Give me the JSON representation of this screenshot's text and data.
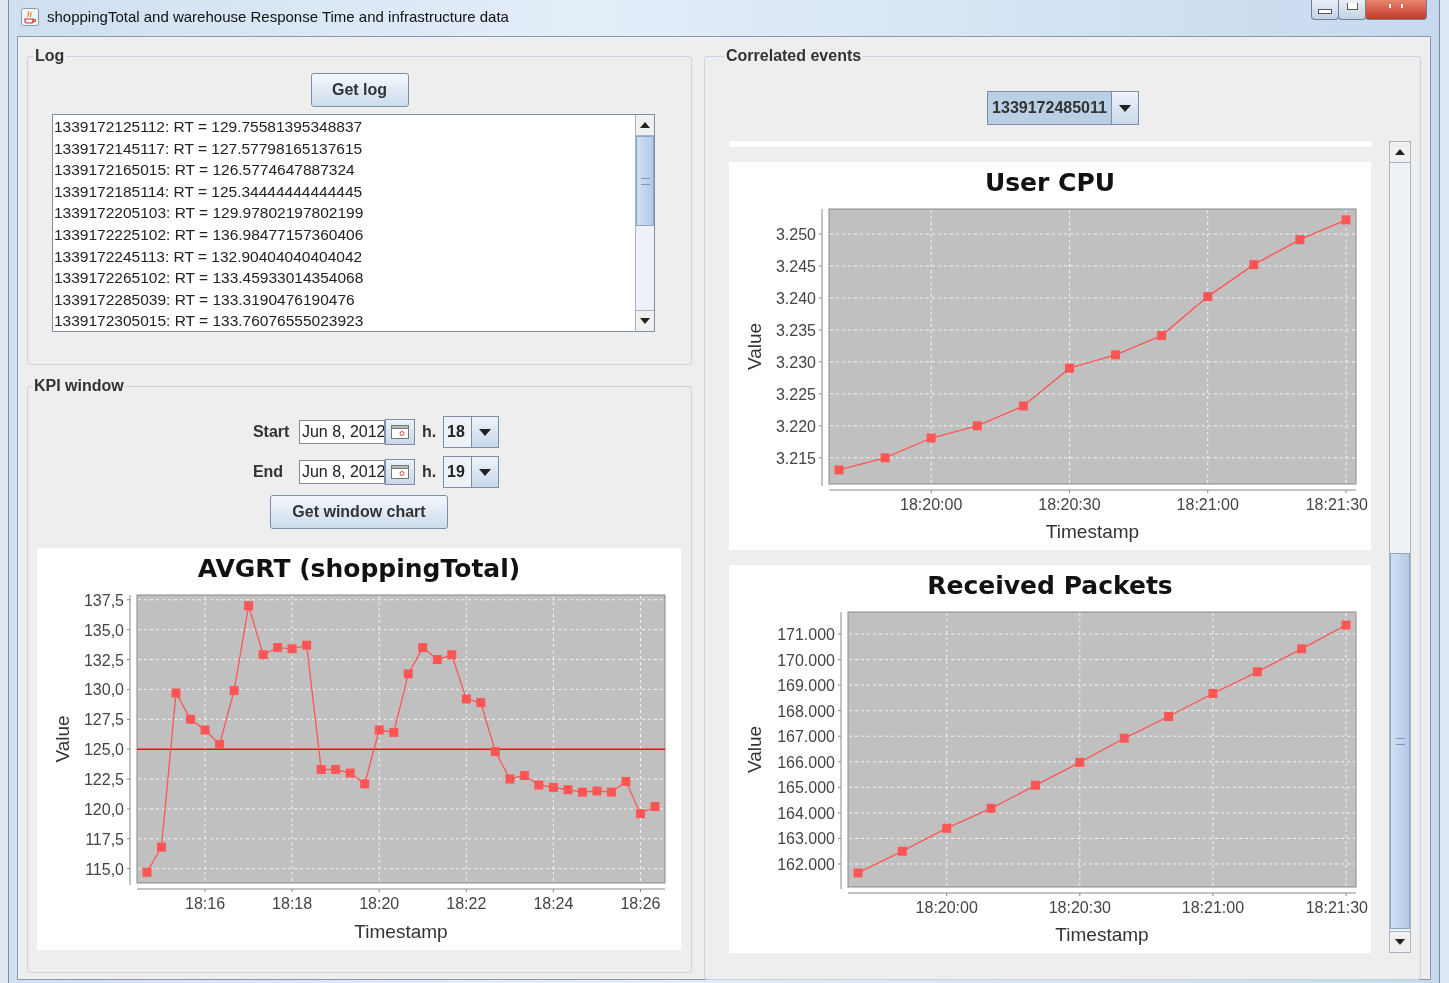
{
  "window": {
    "title": "shoppingTotal and warehouse Response Time and infrastructure data"
  },
  "log": {
    "title": "Log",
    "button": "Get log",
    "lines": [
      "1339172125112: RT = 129.75581395348837",
      "1339172145117: RT = 127.57798165137615",
      "1339172165015: RT = 126.5774647887324",
      "1339172185114: RT = 125.34444444444445",
      "1339172205103: RT = 129.97802197802199",
      "1339172225102: RT = 136.98477157360406",
      "1339172245113: RT = 132.90404040404042",
      "1339172265102: RT = 133.45933014354068",
      "1339172285039: RT = 133.3190476190476",
      "1339172305015: RT = 133.76076555023923"
    ]
  },
  "kpi_window": {
    "title": "KPI window",
    "button": "Get window chart",
    "fields": [
      {
        "label": "Start",
        "date": "Jun 8, 2012",
        "hour_label": "h.",
        "hour": "18"
      },
      {
        "label": "End",
        "date": "Jun 8, 2012",
        "hour_label": "h.",
        "hour": "19"
      }
    ],
    "chart_data": {
      "type": "line",
      "title": "AVGRT (shoppingTotal)",
      "xlabel": "Timestamp",
      "ylabel": "Value",
      "categories": [
        null,
        null,
        null,
        null,
        "18:16",
        null,
        null,
        null,
        null,
        null,
        "18:18",
        null,
        null,
        null,
        null,
        null,
        "18:20",
        null,
        null,
        null,
        null,
        null,
        "18:22",
        null,
        null,
        null,
        null,
        null,
        "18:24",
        null,
        null,
        null,
        null,
        null,
        "18:26",
        null
      ],
      "series": [
        {
          "color": "#ff5555",
          "marker": "square",
          "values": [
            114.7,
            116.8,
            129.7,
            127.5,
            126.6,
            125.4,
            129.9,
            137.0,
            132.9,
            133.5,
            133.4,
            133.7,
            123.3,
            123.3,
            123.0,
            122.1,
            126.6,
            126.4,
            131.3,
            133.5,
            132.5,
            132.9,
            129.2,
            128.9,
            124.8,
            122.5,
            122.8,
            122.0,
            121.8,
            121.6,
            121.4,
            121.5,
            121.4,
            122.3,
            119.6,
            120.2
          ]
        }
      ],
      "ylim": [
        113.8,
        137.9
      ],
      "yticks": [
        {
          "value": 115,
          "label": "115,0"
        },
        {
          "value": 117.5,
          "label": "117,5"
        },
        {
          "value": 120,
          "label": "120,0"
        },
        {
          "value": 122.5,
          "label": "122,5"
        },
        {
          "value": 125,
          "label": "125,0"
        },
        {
          "value": 127.5,
          "label": "127,5"
        },
        {
          "value": 130,
          "label": "130,0"
        },
        {
          "value": 132.5,
          "label": "132,5"
        },
        {
          "value": 135,
          "label": "135,0"
        },
        {
          "value": 137.5,
          "label": "137,5"
        }
      ],
      "grid": true,
      "ref_lines": [
        {
          "axis": "y",
          "value": 125
        }
      ]
    }
  },
  "correlated_events": {
    "title": "Correlated events",
    "selector": "1339172485011",
    "charts": [
      {
        "chart_data": {
          "type": "line",
          "title": "User CPU",
          "xlabel": "Timestamp",
          "ylabel": "Value",
          "categories": [
            null,
            null,
            "18:20:00",
            null,
            null,
            "18:20:30",
            null,
            null,
            "18:21:00",
            null,
            null,
            "18:21:30"
          ],
          "series": [
            {
              "color": "#ff5555",
              "marker": "square",
              "values": [
                3213.1,
                3215,
                3218.1,
                3220,
                3223.1,
                3229,
                3231.1,
                3234.1,
                3240.2,
                3245.2,
                3249.1,
                3252.2
              ]
            }
          ],
          "ylim": [
            3210.9,
            3253.9
          ],
          "grid": true,
          "yticks": [
            {
              "value": 3215,
              "label": "3.215"
            },
            {
              "value": 3220,
              "label": "3.220"
            },
            {
              "value": 3225,
              "label": "3.225"
            },
            {
              "value": 3230,
              "label": "3.230"
            },
            {
              "value": 3235,
              "label": "3.235"
            },
            {
              "value": 3240,
              "label": "3.240"
            },
            {
              "value": 3245,
              "label": "3.245"
            },
            {
              "value": 3250,
              "label": "3.250"
            }
          ]
        }
      },
      {
        "chart_data": {
          "type": "line",
          "title": "Received Packets",
          "xlabel": "Timestamp",
          "ylabel": "Value",
          "categories": [
            null,
            null,
            "18:20:00",
            null,
            null,
            "18:20:30",
            null,
            null,
            "18:21:00",
            null,
            null,
            "18:21:30"
          ],
          "series": [
            {
              "color": "#ff5555",
              "marker": "square",
              "values": [
                161650,
                162500,
                163400,
                164180,
                165080,
                165980,
                166920,
                167770,
                168670,
                169520,
                170420,
                171350
              ]
            }
          ],
          "ylim": [
            161100,
            171860
          ],
          "grid": true,
          "yticks": [
            {
              "value": 162000,
              "label": "162.000"
            },
            {
              "value": 163000,
              "label": "163.000"
            },
            {
              "value": 164000,
              "label": "164.000"
            },
            {
              "value": 165000,
              "label": "165.000"
            },
            {
              "value": 166000,
              "label": "166.000"
            },
            {
              "value": 167000,
              "label": "167.000"
            },
            {
              "value": 168000,
              "label": "168.000"
            },
            {
              "value": 169000,
              "label": "169.000"
            },
            {
              "value": 170000,
              "label": "170.000"
            },
            {
              "value": 171000,
              "label": "171.000"
            }
          ]
        }
      }
    ]
  }
}
